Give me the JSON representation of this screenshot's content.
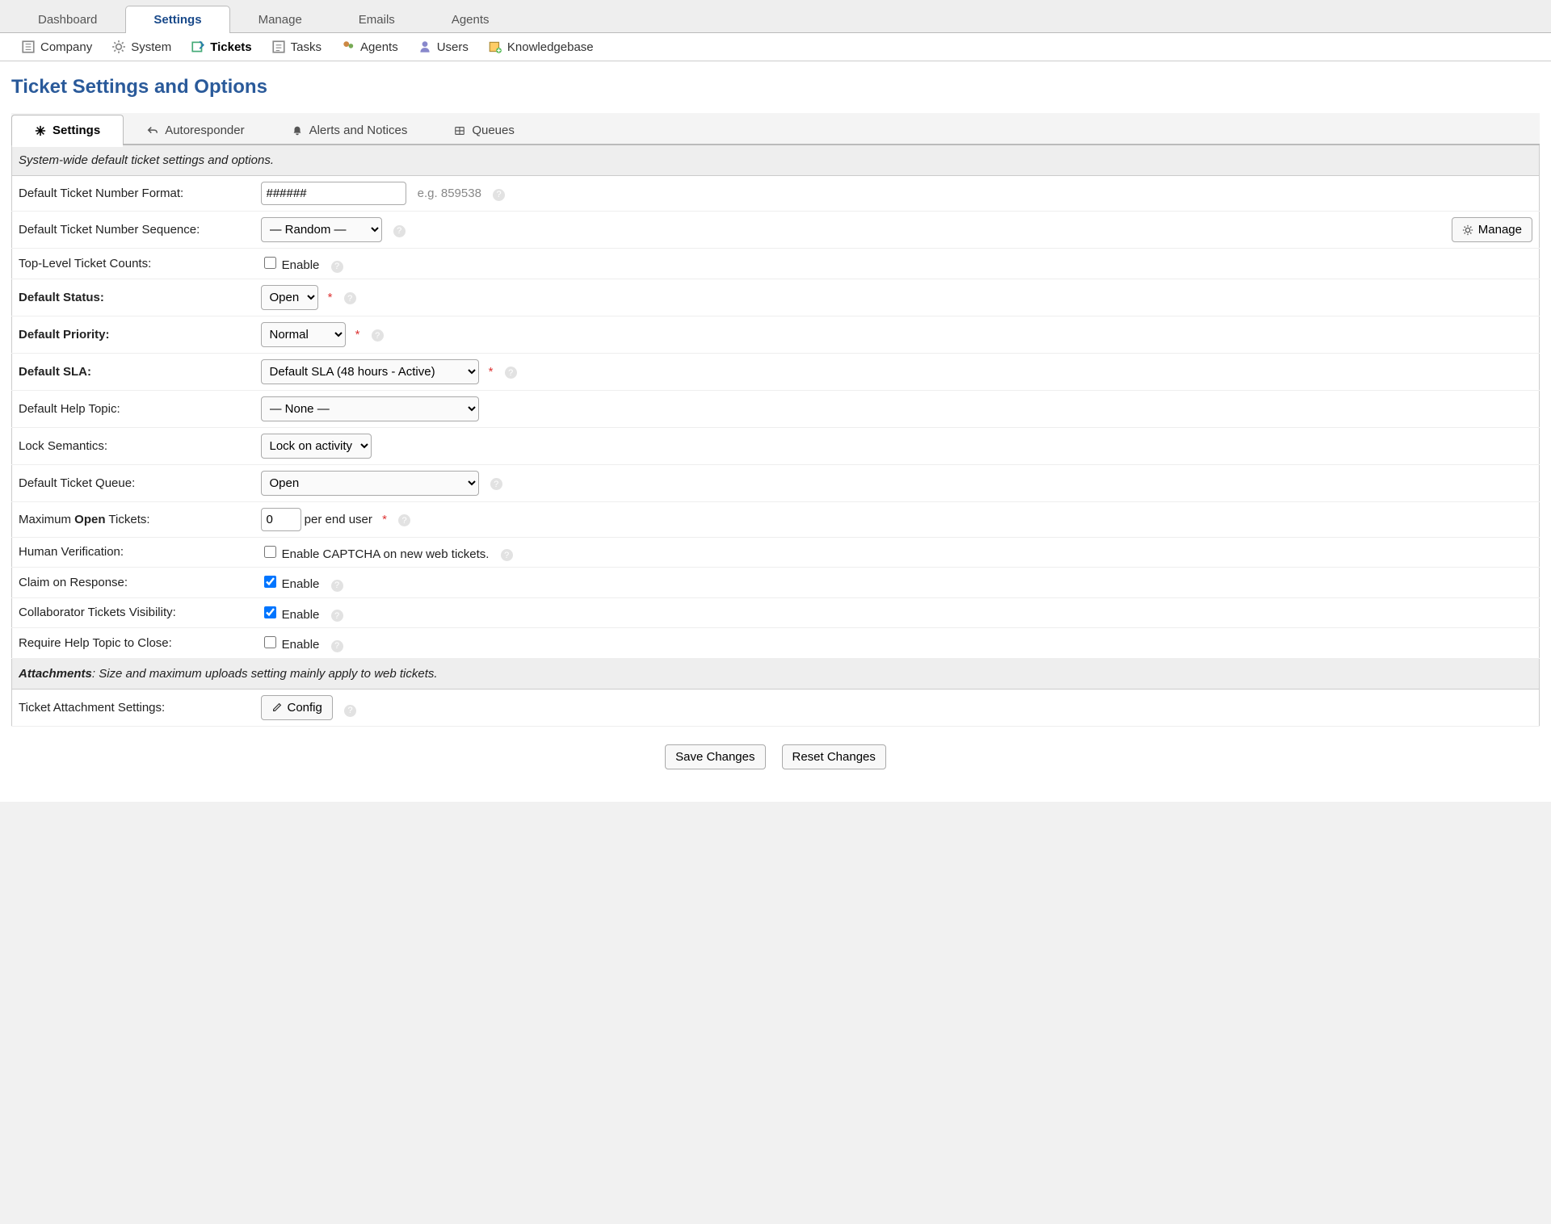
{
  "topnav": {
    "tabs": [
      "Dashboard",
      "Settings",
      "Manage",
      "Emails",
      "Agents"
    ],
    "active": 1
  },
  "subnav": {
    "items": [
      "Company",
      "System",
      "Tickets",
      "Tasks",
      "Agents",
      "Users",
      "Knowledgebase"
    ],
    "active": 2
  },
  "page_title": "Ticket Settings and Options",
  "innertabs": {
    "tabs": [
      "Settings",
      "Autoresponder",
      "Alerts and Notices",
      "Queues"
    ],
    "active": 0
  },
  "section1_header": "System-wide default ticket settings and options.",
  "fields": {
    "number_format": {
      "label": "Default Ticket Number Format:",
      "value": "######",
      "eg": "e.g. 859538"
    },
    "number_sequence": {
      "label": "Default Ticket Number Sequence:",
      "value": "— Random —",
      "manage_btn": "Manage"
    },
    "top_level_counts": {
      "label": "Top-Level Ticket Counts:",
      "option": "Enable",
      "checked": false
    },
    "default_status": {
      "label": "Default Status:",
      "value": "Open"
    },
    "default_priority": {
      "label": "Default Priority:",
      "value": "Normal"
    },
    "default_sla": {
      "label": "Default SLA:",
      "value": "Default SLA (48 hours - Active)"
    },
    "default_help_topic": {
      "label": "Default Help Topic:",
      "value": "— None —"
    },
    "lock_semantics": {
      "label": "Lock Semantics:",
      "value": "Lock on activity"
    },
    "default_queue": {
      "label": "Default Ticket Queue:",
      "value": "Open"
    },
    "max_open": {
      "label_pre": "Maximum ",
      "label_bold": "Open",
      "label_post": " Tickets:",
      "value": "0",
      "suffix": "per end user"
    },
    "human_verify": {
      "label": "Human Verification:",
      "option": "Enable CAPTCHA on new web tickets.",
      "checked": false
    },
    "claim_response": {
      "label": "Claim on Response:",
      "option": "Enable",
      "checked": true
    },
    "collab_vis": {
      "label": "Collaborator Tickets Visibility:",
      "option": "Enable",
      "checked": true
    },
    "require_topic_close": {
      "label": "Require Help Topic to Close:",
      "option": "Enable",
      "checked": false
    }
  },
  "section2_header_bold": "Attachments",
  "section2_header_rest": ": Size and maximum uploads setting mainly apply to web tickets.",
  "attach": {
    "label": "Ticket Attachment Settings:",
    "btn": "Config"
  },
  "actions": {
    "save": "Save Changes",
    "reset": "Reset Changes"
  }
}
